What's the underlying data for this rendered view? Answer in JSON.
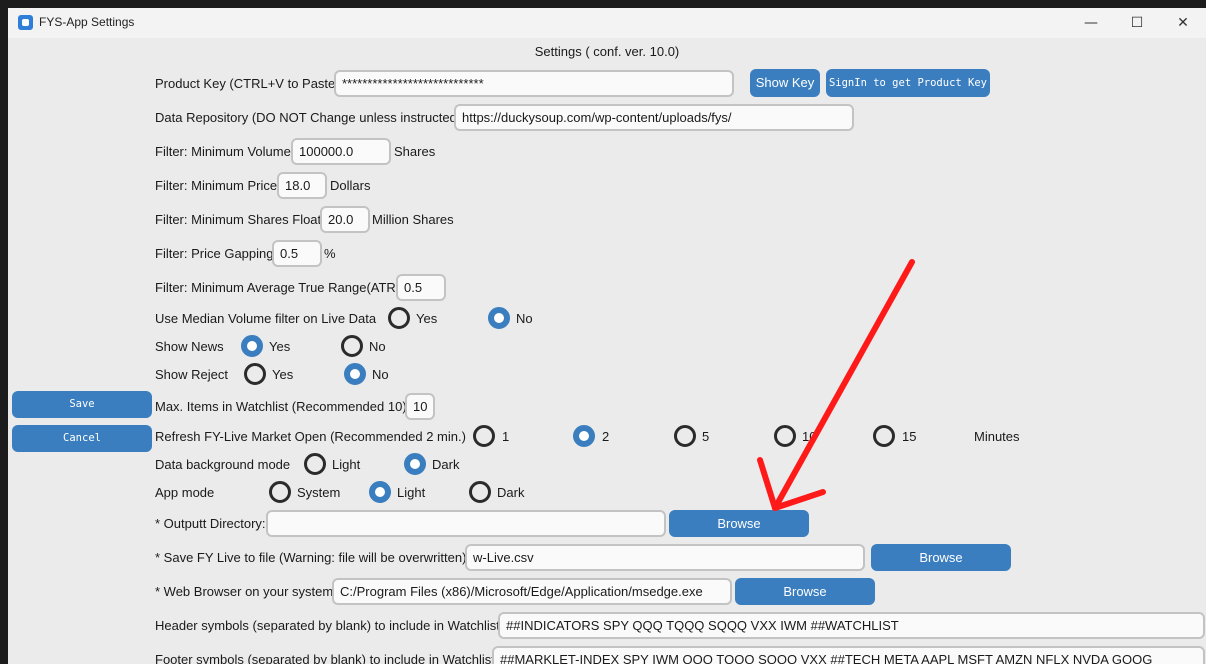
{
  "window": {
    "title": "FYS-App Settings",
    "controls": {
      "minimize": "—",
      "maximize": "☐",
      "close": "✕"
    }
  },
  "header": {
    "title": "Settings ( conf. ver. 10.0)"
  },
  "sidebar": {
    "save": "Save",
    "cancel": "Cancel"
  },
  "form": {
    "product_key": {
      "label": "Product Key (CTRL+V to Paste)",
      "value": "****************************",
      "show_key": "Show Key",
      "signin": "SignIn to get Product Key"
    },
    "data_repo": {
      "label": "Data Repository (DO NOT Change unless instructed)",
      "value": "https://duckysoup.com/wp-content/uploads/fys/"
    },
    "min_volume": {
      "label": "Filter: Minimum Volume",
      "value": "100000.0",
      "unit": "Shares"
    },
    "min_price": {
      "label": "Filter: Minimum Price",
      "value": "18.0",
      "unit": "Dollars"
    },
    "min_float": {
      "label": "Filter: Minimum Shares Float",
      "value": "20.0",
      "unit": "Million Shares"
    },
    "gapping": {
      "label": "Filter: Price Gapping",
      "value": "0.5",
      "unit": "%"
    },
    "atr": {
      "label": "Filter: Minimum Average True Range(ATR)",
      "value": "0.5"
    },
    "median_volume": {
      "label": "Use Median Volume filter on Live Data",
      "opt1": "Yes",
      "opt2": "No",
      "selected": "No"
    },
    "show_news": {
      "label": "Show News",
      "opt1": "Yes",
      "opt2": "No",
      "selected": "Yes"
    },
    "show_reject": {
      "label": "Show Reject",
      "opt1": "Yes",
      "opt2": "No",
      "selected": "No"
    },
    "max_items": {
      "label": "Max. Items in Watchlist (Recommended 10)",
      "value": "10"
    },
    "refresh": {
      "label": "Refresh FY-Live Market Open (Recommended 2 min.)",
      "opts": [
        "1",
        "2",
        "5",
        "10",
        "15"
      ],
      "selected": "2",
      "unit": "Minutes"
    },
    "bg_mode": {
      "label": "Data background mode",
      "opt1": "Light",
      "opt2": "Dark",
      "selected": "Dark"
    },
    "app_mode": {
      "label": "App mode",
      "opt1": "System",
      "opt2": "Light",
      "opt3": "Dark",
      "selected": "Light"
    },
    "output_dir": {
      "label": "* Outputt Directory:",
      "value": "",
      "browse": "Browse"
    },
    "save_live": {
      "label": "* Save FY Live to file (Warning: file will be overwritten):",
      "value": "w-Live.csv",
      "browse": "Browse"
    },
    "web_browser": {
      "label": "* Web Browser on your system",
      "value": "C:/Program Files (x86)/Microsoft/Edge/Application/msedge.exe",
      "browse": "Browse"
    },
    "header_symbols": {
      "label": "Header symbols (separated by blank) to include in Watchlist",
      "value": "##INDICATORS SPY QQQ TQQQ SQQQ VXX IWM ##WATCHLIST"
    },
    "footer_symbols": {
      "label": "Footer symbols (separated by blank) to include in Watchlist",
      "value": "##MARKLET-INDEX SPY IWM QQQ TQQQ SQQQ VXX ##TECH META AAPL MSFT AMZN NFLX NVDA GOOG"
    }
  },
  "annotation": {
    "arrow_color": "#ff1a1a"
  }
}
